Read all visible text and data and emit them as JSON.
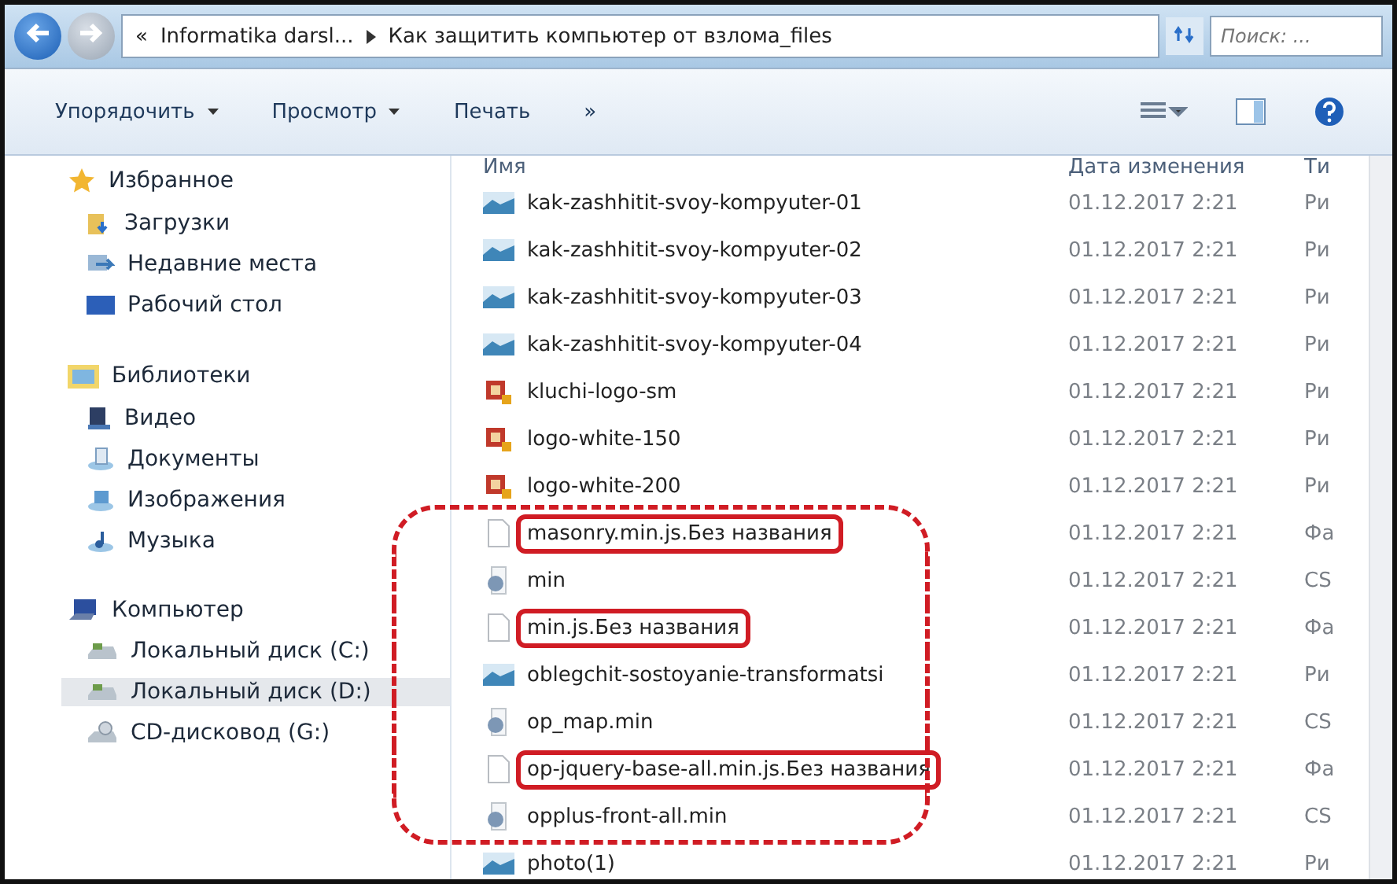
{
  "address_bar": {
    "overflow": "«",
    "crumbs": [
      "Informatika darsl...",
      "Как защитить компьютер от взлома_files"
    ],
    "search_placeholder": "Поиск: ..."
  },
  "toolbar": {
    "items": [
      {
        "label": "Упорядочить",
        "dropdown": true
      },
      {
        "label": "Просмотр",
        "dropdown": true
      },
      {
        "label": "Печать",
        "dropdown": false
      }
    ],
    "more": "»"
  },
  "nav": [
    {
      "label": "Избранное",
      "kind": "star",
      "children": [
        {
          "label": "Загрузки",
          "kind": "downloads",
          "selected": false
        },
        {
          "label": "Недавние места",
          "kind": "recent",
          "selected": false
        },
        {
          "label": "Рабочий стол",
          "kind": "desktop",
          "selected": false
        }
      ]
    },
    {
      "label": "Библиотеки",
      "kind": "libraries",
      "children": [
        {
          "label": "Видео",
          "kind": "video",
          "selected": false
        },
        {
          "label": "Документы",
          "kind": "documents",
          "selected": false
        },
        {
          "label": "Изображения",
          "kind": "pictures",
          "selected": false
        },
        {
          "label": "Музыка",
          "kind": "music",
          "selected": false
        }
      ]
    },
    {
      "label": "Компьютер",
      "kind": "computer",
      "children": [
        {
          "label": "Локальный диск (C:)",
          "kind": "drive",
          "selected": false
        },
        {
          "label": "Локальный диск (D:)",
          "kind": "drive",
          "selected": true
        },
        {
          "label": "CD-дисковод (G:)",
          "kind": "cd",
          "selected": false
        }
      ]
    }
  ],
  "table": {
    "columns": [
      "Имя",
      "Дата изменения",
      "Ти"
    ],
    "rows": [
      {
        "name": "kak-zashhitit-svoy-kompyuter-01",
        "date": "01.12.2017 2:21",
        "type": "Ри",
        "kind": "image",
        "highlighted": false,
        "in_group": false
      },
      {
        "name": "kak-zashhitit-svoy-kompyuter-02",
        "date": "01.12.2017 2:21",
        "type": "Ри",
        "kind": "image",
        "highlighted": false,
        "in_group": false
      },
      {
        "name": "kak-zashhitit-svoy-kompyuter-03",
        "date": "01.12.2017 2:21",
        "type": "Ри",
        "kind": "image",
        "highlighted": false,
        "in_group": false
      },
      {
        "name": "kak-zashhitit-svoy-kompyuter-04",
        "date": "01.12.2017 2:21",
        "type": "Ри",
        "kind": "image",
        "highlighted": false,
        "in_group": false
      },
      {
        "name": "kluchi-logo-sm",
        "date": "01.12.2017 2:21",
        "type": "Ри",
        "kind": "logo",
        "highlighted": false,
        "in_group": false
      },
      {
        "name": "logo-white-150",
        "date": "01.12.2017 2:21",
        "type": "Ри",
        "kind": "logo",
        "highlighted": false,
        "in_group": false
      },
      {
        "name": "logo-white-200",
        "date": "01.12.2017 2:21",
        "type": "Ри",
        "kind": "logo",
        "highlighted": false,
        "in_group": false
      },
      {
        "name": "masonry.min.js.Без названия",
        "date": "01.12.2017 2:21",
        "type": "Фа",
        "kind": "file",
        "highlighted": true,
        "in_group": true
      },
      {
        "name": "min",
        "date": "01.12.2017 2:21",
        "type": "CS",
        "kind": "css",
        "highlighted": false,
        "in_group": true
      },
      {
        "name": "min.js.Без названия",
        "date": "01.12.2017 2:21",
        "type": "Фа",
        "kind": "file",
        "highlighted": true,
        "in_group": true
      },
      {
        "name": "oblegchit-sostoyanie-transformatsi",
        "date": "01.12.2017 2:21",
        "type": "Ри",
        "kind": "image",
        "highlighted": false,
        "in_group": true
      },
      {
        "name": "op_map.min",
        "date": "01.12.2017 2:21",
        "type": "CS",
        "kind": "css",
        "highlighted": false,
        "in_group": true
      },
      {
        "name": "op-jquery-base-all.min.js.Без названия",
        "date": "01.12.2017 2:21",
        "type": "Фа",
        "kind": "file",
        "highlighted": true,
        "in_group": true
      },
      {
        "name": "opplus-front-all.min",
        "date": "01.12.2017 2:21",
        "type": "CS",
        "kind": "css",
        "highlighted": false,
        "in_group": true
      },
      {
        "name": "photo(1)",
        "date": "01.12.2017 2:21",
        "type": "Ри",
        "kind": "image",
        "highlighted": false,
        "in_group": false
      }
    ]
  }
}
